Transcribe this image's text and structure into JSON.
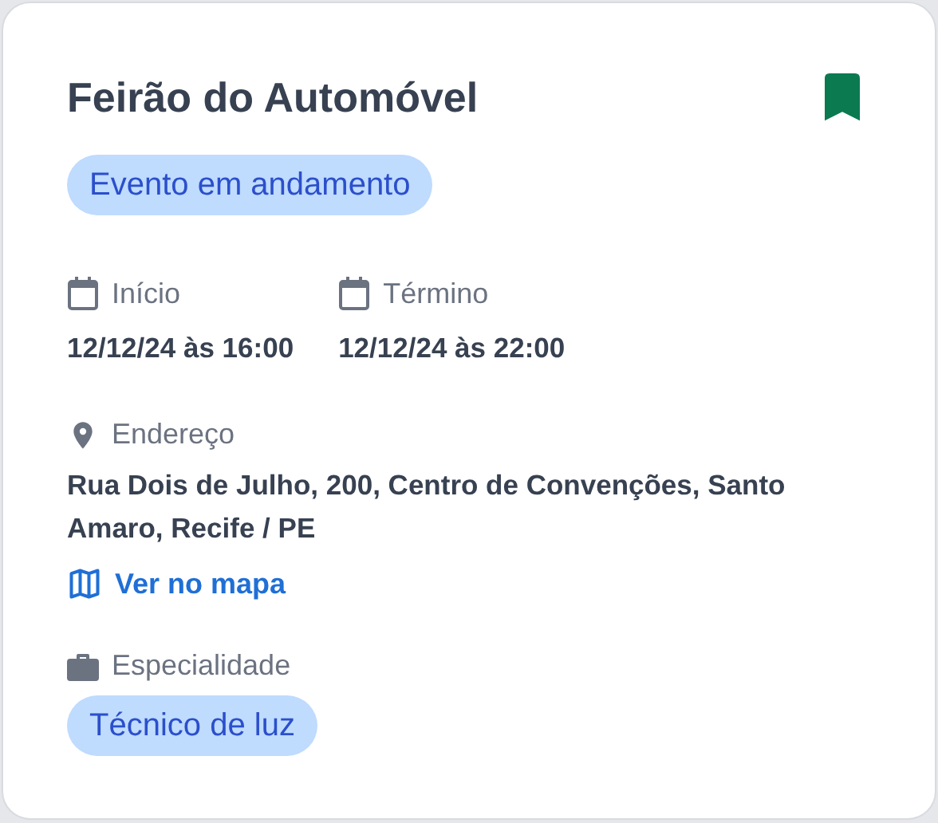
{
  "title": "Feirão do Automóvel",
  "bookmark": {
    "saved": true
  },
  "status_badge": "Evento em andamento",
  "dates": [
    {
      "label": "Início",
      "value": "12/12/24 às 16:00"
    },
    {
      "label": "Término",
      "value": "12/12/24 às 22:00"
    }
  ],
  "address": {
    "label": "Endereço",
    "value": "Rua Dois de Julho, 200, Centro de Convenções, Santo Amaro, Recife / PE",
    "link": "Ver no mapa"
  },
  "specialty": {
    "label": "Especialidade",
    "tags": [
      "Técnico de luz"
    ]
  }
}
